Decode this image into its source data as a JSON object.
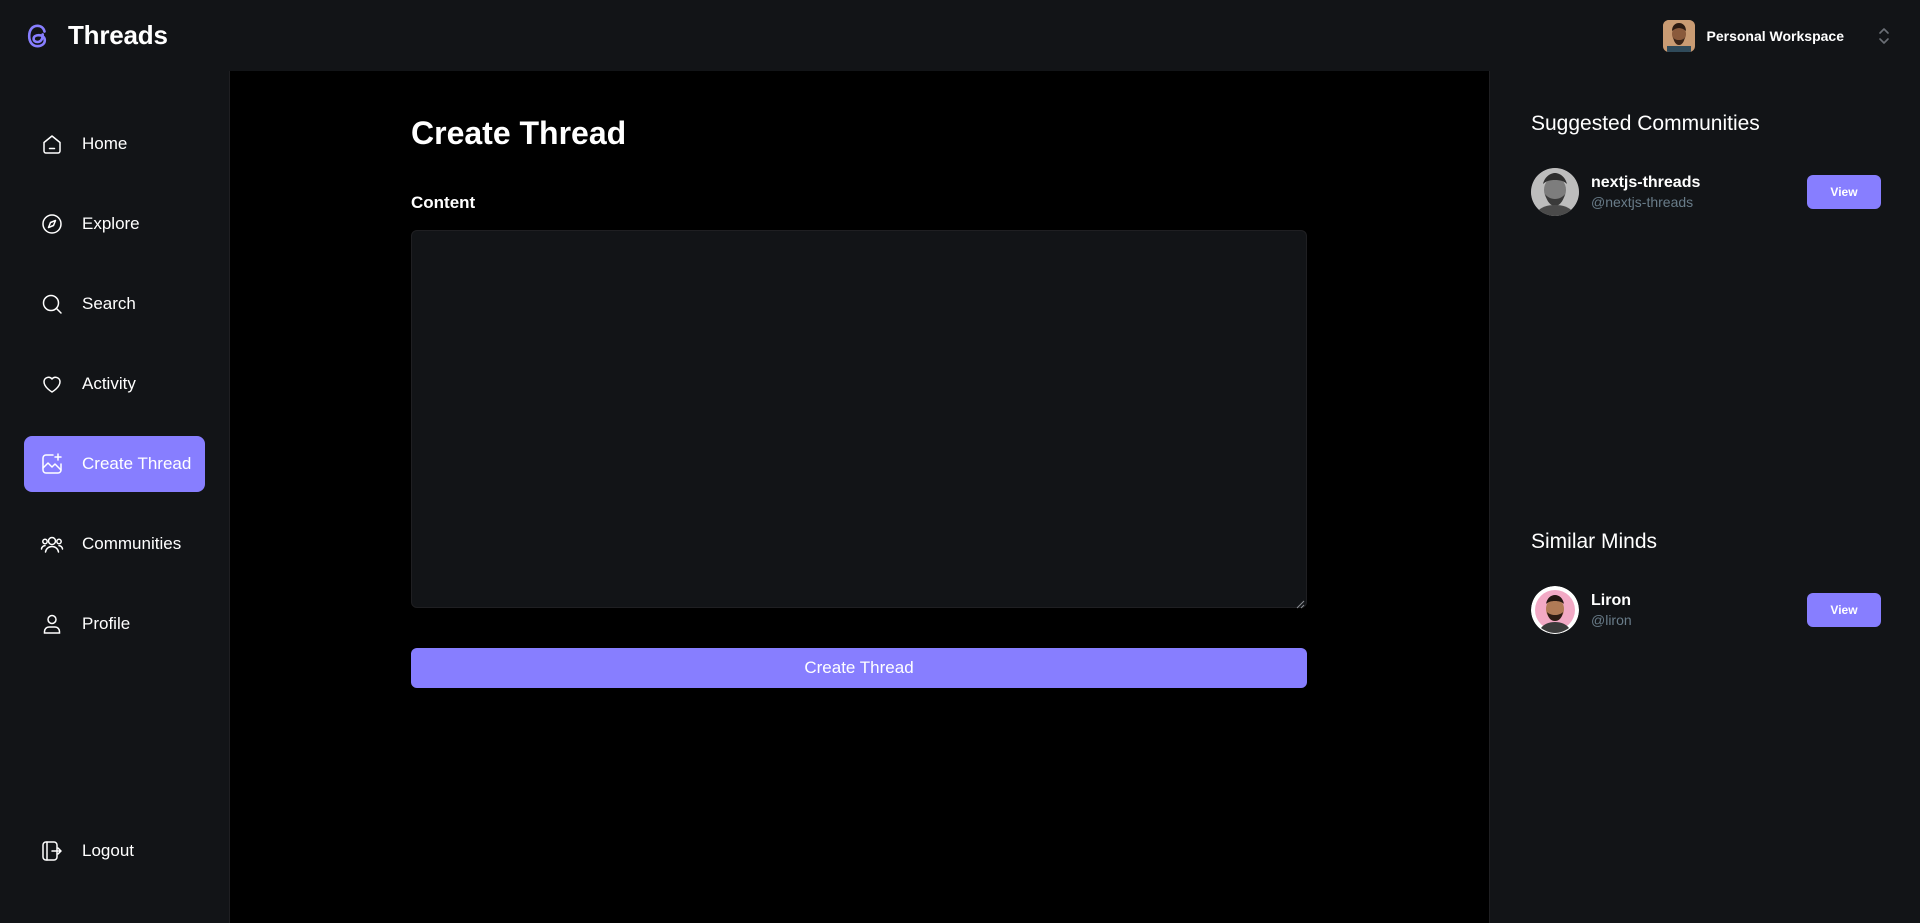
{
  "app": {
    "name": "Threads",
    "accent": "#877EFF"
  },
  "workspace": {
    "name": "Personal Workspace"
  },
  "sidebar": {
    "items": [
      {
        "label": "Home",
        "icon": "home-icon"
      },
      {
        "label": "Explore",
        "icon": "compass-icon"
      },
      {
        "label": "Search",
        "icon": "search-icon"
      },
      {
        "label": "Activity",
        "icon": "heart-icon"
      },
      {
        "label": "Create Thread",
        "icon": "image-plus-icon",
        "active": true
      },
      {
        "label": "Communities",
        "icon": "users-icon"
      },
      {
        "label": "Profile",
        "icon": "user-icon"
      }
    ],
    "logout": {
      "label": "Logout",
      "icon": "logout-icon"
    }
  },
  "main": {
    "title": "Create Thread",
    "content_label": "Content",
    "content_value": "",
    "submit_label": "Create Thread"
  },
  "rightbar": {
    "suggested_title": "Suggested Communities",
    "communities": [
      {
        "name": "nextjs-threads",
        "handle": "@nextjs-threads",
        "button": "View"
      }
    ],
    "similar_title": "Similar Minds",
    "users": [
      {
        "name": "Liron",
        "handle": "@liron",
        "button": "View"
      }
    ]
  }
}
